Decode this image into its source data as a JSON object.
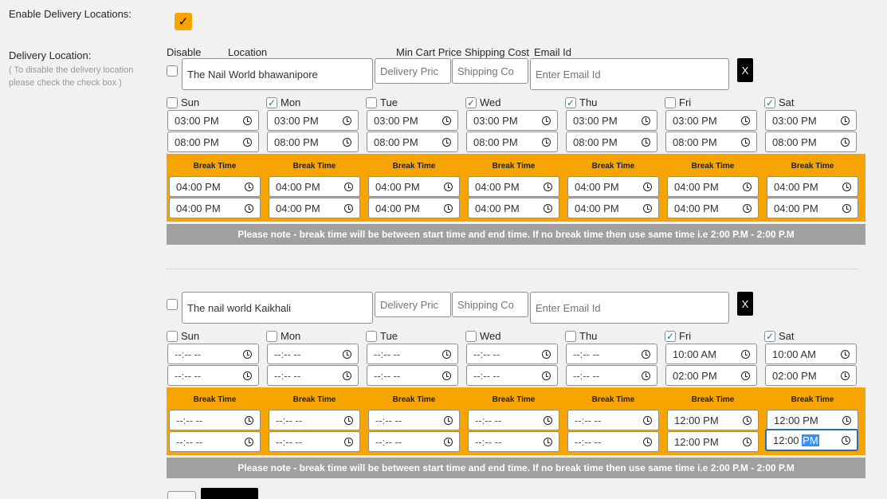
{
  "settings": {
    "enable_label": "Enable Delivery Locations:",
    "enable_checked": true,
    "delivery_label": "Delivery Location:",
    "delivery_hint": "( To disable the delivery location please check the check box )"
  },
  "columns": {
    "disable": "Disable",
    "location": "Location",
    "min_cart": "Min Cart Price",
    "shipping": "Shipping Cost",
    "email": "Email Id"
  },
  "placeholders": {
    "min_cart": "Delivery Pric",
    "shipping": "Shipping Co",
    "email": "Enter Email Id"
  },
  "remove_label": "X",
  "break_label": "Break Time",
  "note": "Please note - break time will be between start time and end time. If no break time then use same time i.e 2:00 P.M - 2:00 P.M",
  "locations": [
    {
      "name": "The Nail World bhawanipore",
      "days": [
        {
          "label": "Sun",
          "checked": false,
          "start": "03:00 PM",
          "end": "08:00 PM",
          "break_start": "04:00 PM",
          "break_end": "04:00 PM"
        },
        {
          "label": "Mon",
          "checked": true,
          "start": "03:00 PM",
          "end": "08:00 PM",
          "break_start": "04:00 PM",
          "break_end": "04:00 PM"
        },
        {
          "label": "Tue",
          "checked": false,
          "start": "03:00 PM",
          "end": "08:00 PM",
          "break_start": "04:00 PM",
          "break_end": "04:00 PM"
        },
        {
          "label": "Wed",
          "checked": true,
          "start": "03:00 PM",
          "end": "08:00 PM",
          "break_start": "04:00 PM",
          "break_end": "04:00 PM"
        },
        {
          "label": "Thu",
          "checked": true,
          "start": "03:00 PM",
          "end": "08:00 PM",
          "break_start": "04:00 PM",
          "break_end": "04:00 PM"
        },
        {
          "label": "Fri",
          "checked": false,
          "start": "03:00 PM",
          "end": "08:00 PM",
          "break_start": "04:00 PM",
          "break_end": "04:00 PM"
        },
        {
          "label": "Sat",
          "checked": true,
          "start": "03:00 PM",
          "end": "08:00 PM",
          "break_start": "04:00 PM",
          "break_end": "04:00 PM"
        }
      ]
    },
    {
      "name": "The nail world Kaikhali",
      "days": [
        {
          "label": "Sun",
          "checked": false,
          "start": "--:-- --",
          "end": "--:-- --",
          "break_start": "--:-- --",
          "break_end": "--:-- --"
        },
        {
          "label": "Mon",
          "checked": false,
          "start": "--:-- --",
          "end": "--:-- --",
          "break_start": "--:-- --",
          "break_end": "--:-- --"
        },
        {
          "label": "Tue",
          "checked": false,
          "start": "--:-- --",
          "end": "--:-- --",
          "break_start": "--:-- --",
          "break_end": "--:-- --"
        },
        {
          "label": "Wed",
          "checked": false,
          "start": "--:-- --",
          "end": "--:-- --",
          "break_start": "--:-- --",
          "break_end": "--:-- --"
        },
        {
          "label": "Thu",
          "checked": false,
          "start": "--:-- --",
          "end": "--:-- --",
          "break_start": "--:-- --",
          "break_end": "--:-- --"
        },
        {
          "label": "Fri",
          "checked": true,
          "start": "10:00 AM",
          "end": "02:00 PM",
          "break_start": "12:00 PM",
          "break_end": "12:00 PM"
        },
        {
          "label": "Sat",
          "checked": true,
          "start": "10:00 AM",
          "end": "02:00 PM",
          "break_start": "12:00 PM",
          "break_end": "12:00 PM"
        }
      ]
    }
  ],
  "colors": {
    "accent": "#f7a400",
    "note_bg": "#a0a0a0",
    "focus": "#2271b1"
  }
}
